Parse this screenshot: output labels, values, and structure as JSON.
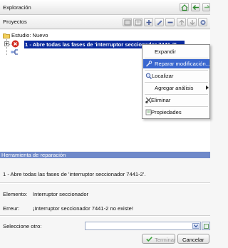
{
  "explorer": {
    "title": "Exploración"
  },
  "projects": {
    "title": "Proyectos"
  },
  "tree": {
    "root_label": "Estudio: Nuevo",
    "selected_item_label": "1 - Abre todas las fases de 'interruptor seccionador 7441-2'"
  },
  "context_menu": {
    "items": [
      {
        "label": "Expandir"
      },
      {
        "label": "Reparar modificación..."
      },
      {
        "label": "Localizar"
      },
      {
        "label": "Agregar análisis"
      },
      {
        "label": "Eliminar"
      },
      {
        "label": "Propiedades"
      }
    ]
  },
  "repair_tool": {
    "title": "Herramienta de reparación",
    "description": "1 - Abre todas las fases de 'interruptor seccionador 7441-2'.",
    "element_label": "Elemento:",
    "element_value": "Interruptor seccionador",
    "error_label": "Erreur:",
    "error_value": "¡Interruptor seccionador 7441-2 no existe!",
    "select_other_label": "Seleccione otro:",
    "select_other_value": "",
    "finish_label": "Terminar",
    "cancel_label": "Cancelar"
  },
  "colors": {
    "selection": "#0a2a9e",
    "menu_highlight": "#3a67cf",
    "panel_header": "#6f89c9",
    "error_badge": "#d12a1f",
    "checkmark": "#3aa33a"
  }
}
